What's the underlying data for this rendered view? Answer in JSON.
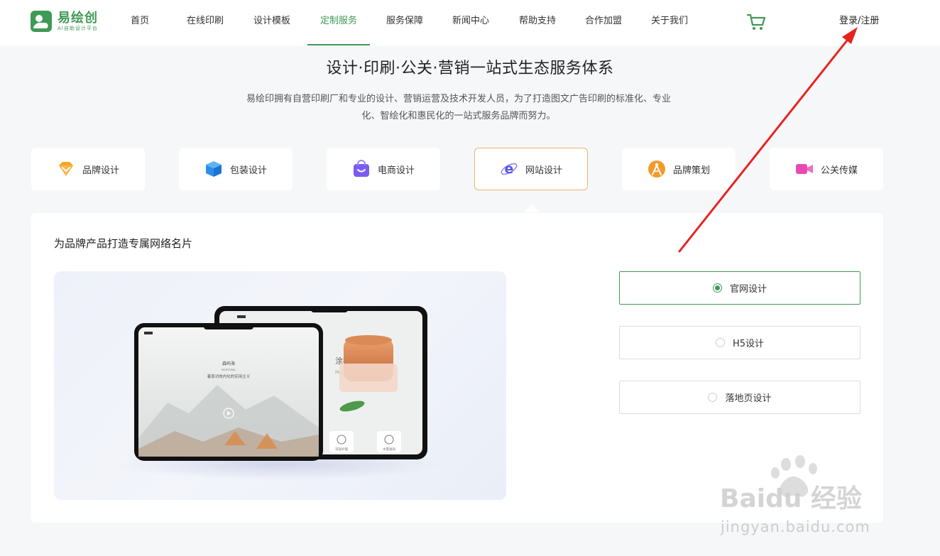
{
  "header": {
    "logo_title": "易绘创",
    "logo_sub": "AI自助设计平台",
    "nav": [
      {
        "label": "首页"
      },
      {
        "label": "在线印刷"
      },
      {
        "label": "设计模板"
      },
      {
        "label": "定制服务",
        "active": true
      },
      {
        "label": "服务保障"
      },
      {
        "label": "新闻中心"
      },
      {
        "label": "帮助支持"
      },
      {
        "label": "合作加盟"
      },
      {
        "label": "关于我们"
      }
    ],
    "cart_icon": "shopping-cart-icon",
    "login_label": "登录/注册"
  },
  "hero": {
    "title": "设计·印刷·公关·营销一站式生态服务体系",
    "desc_line1": "易绘印拥有自营印刷厂和专业的设计、营销运营及技术开发人员，为了打造图文广告印刷的标准化、专业",
    "desc_line2": "化、智绘化和惠民化的一站式服务品牌而努力。"
  },
  "services": [
    {
      "label": "品牌设计",
      "icon": "diamond-icon",
      "color": "#f5a623"
    },
    {
      "label": "包装设计",
      "icon": "box-icon",
      "color": "#2b8fe8"
    },
    {
      "label": "电商设计",
      "icon": "shopping-bag-icon",
      "color": "#7b5cf0"
    },
    {
      "label": "网站设计",
      "icon": "browser-e-icon",
      "color": "#5a55e6",
      "active": true
    },
    {
      "label": "品牌策划",
      "icon": "compass-icon",
      "color": "#f39a2a"
    },
    {
      "label": "公关传媒",
      "icon": "video-camera-icon",
      "color": "#e84bb0"
    }
  ],
  "panel": {
    "title": "为品牌产品打造专属网络名片",
    "options": [
      {
        "label": "官网设计",
        "selected": true
      },
      {
        "label": "H5设计",
        "selected": false
      },
      {
        "label": "落地页设计",
        "selected": false
      }
    ],
    "mockup": {
      "back_text": "涂抹面膜?",
      "back_sub": "Mask?",
      "front_brand": "森屿海",
      "front_brand_en": "MOISTURAL",
      "front_slogan": "着靠功效内化的实用主义",
      "btn1": "深层护理",
      "btn2": "水量滋润"
    }
  },
  "watermark": {
    "brand": "Baidu 经验",
    "url": "jingyan.baidu.com"
  },
  "colors": {
    "brand_green": "#3f9a55",
    "active_tab_border": "#f0b36b",
    "annotation_arrow": "#e8231f"
  }
}
